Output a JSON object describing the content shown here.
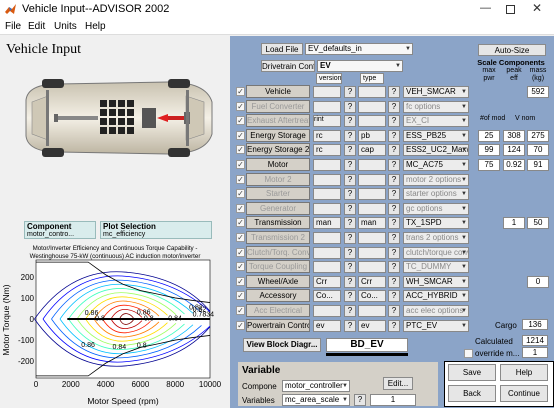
{
  "window": {
    "title": "Vehicle Input--ADVISOR 2002"
  },
  "menu": [
    "File",
    "Edit",
    "Units",
    "Help"
  ],
  "heading": "Vehicle Input",
  "component_select": {
    "label": "Component",
    "value": "motor_contro..."
  },
  "plot_select": {
    "label": "Plot Selection",
    "value": "mc_efficiency"
  },
  "plot": {
    "title_line1": "Motor/Inverter Efficiency and Continuous Torque Capability -",
    "title_line2": "Westinghouse 75-kW (continuous) AC induction motor/inverter",
    "xlabel": "Motor Speed (rpm)",
    "ylabel": "Motor Torque (Nm)",
    "xticks": [
      "0",
      "2000",
      "4000",
      "6000",
      "8000",
      "10000"
    ],
    "yticks": [
      "-200",
      "-100",
      "0",
      "100",
      "200"
    ],
    "contour_labels": [
      {
        "text": "0.86",
        "x": 2800,
        "y": 18
      },
      {
        "text": "0.86",
        "x": 5800,
        "y": 22
      },
      {
        "text": "0.8",
        "x": 3400,
        "y": -8
      },
      {
        "text": "0.8",
        "x": 6200,
        "y": -6
      },
      {
        "text": "0.84",
        "x": 7600,
        "y": -8
      },
      {
        "text": "0.7834",
        "x": 9000,
        "y": 12
      },
      {
        "text": "0.82",
        "x": 8800,
        "y": 44
      },
      {
        "text": "0.82",
        "x": 9000,
        "y": 36
      },
      {
        "text": "0.86",
        "x": 2600,
        "y": -132
      },
      {
        "text": "0.8",
        "x": 5800,
        "y": -136
      },
      {
        "text": "0.84",
        "x": 4400,
        "y": -142
      }
    ],
    "contour_levels": [
      0.5,
      0.6,
      0.7,
      0.75,
      0.78,
      0.8,
      0.82,
      0.84,
      0.86,
      0.88,
      0.9
    ],
    "contour_colors": [
      "#00008f",
      "#0000ff",
      "#0060ff",
      "#00bfff",
      "#40ffbf",
      "#9fff60",
      "#ffdf00",
      "#ff8000",
      "#ff2000",
      "#bf0000",
      "#800000"
    ],
    "xlim": [
      0,
      10000
    ],
    "ylim": [
      -280,
      280
    ],
    "max_torque_curve": [
      [
        0,
        270
      ],
      [
        3000,
        270
      ],
      [
        4000,
        210
      ],
      [
        5000,
        165
      ],
      [
        6000,
        135
      ],
      [
        7000,
        118
      ],
      [
        8000,
        100
      ],
      [
        9000,
        88
      ],
      [
        10000,
        78
      ]
    ]
  },
  "load_file": {
    "label": "Load File",
    "value": "EV_defaults_in"
  },
  "drivetrain": {
    "label": "Drivetrain Config",
    "value": "EV"
  },
  "col_headers": {
    "version": "version",
    "type": "type"
  },
  "auto_size_label": "Auto-Size",
  "scale": {
    "title": "Scale Components",
    "max_pwr": "max\npwr",
    "peak_eff": "peak\neff",
    "mass": "mass\n(kg)",
    "num_mod": "#of mod",
    "v_nom": "V nom"
  },
  "components": [
    {
      "name": "Vehicle",
      "checked": true,
      "active": true,
      "version": "",
      "type": "",
      "file": "VEH_SMCAR",
      "file_dim": false,
      "nums": [
        "",
        "",
        "592"
      ]
    },
    {
      "name": "Fuel Converter",
      "checked": true,
      "active": false,
      "version": "",
      "type": "",
      "file": "fc options",
      "file_dim": true,
      "nums": [
        "",
        "",
        ""
      ]
    },
    {
      "name": "Exhaust Aftertreat",
      "checked": true,
      "active": false,
      "version": "",
      "type": "",
      "file": "EX_CI",
      "file_dim": true,
      "nums": [
        "",
        "",
        ""
      ]
    },
    {
      "name": "Energy Storage",
      "checked": true,
      "active": true,
      "version": "rc",
      "type": "pb",
      "file": "ESS_PB25",
      "file_dim": false,
      "nums": [
        "25",
        "308",
        "275"
      ]
    },
    {
      "name": "Energy Storage 2",
      "checked": true,
      "active": true,
      "version": "rc",
      "type": "cap",
      "file": "ESS2_UC2_Maxwell",
      "file_dim": false,
      "nums": [
        "99",
        "124",
        "70"
      ]
    },
    {
      "name": "Motor",
      "checked": true,
      "active": true,
      "version": "",
      "type": "",
      "file": "MC_AC75",
      "file_dim": false,
      "nums": [
        "75",
        "0.92",
        "91"
      ]
    },
    {
      "name": "Motor 2",
      "checked": true,
      "active": false,
      "version": "",
      "type": "",
      "file": "motor 2 options",
      "file_dim": true,
      "nums": [
        "",
        "",
        ""
      ]
    },
    {
      "name": "Starter",
      "checked": true,
      "active": false,
      "version": "",
      "type": "",
      "file": "starter options",
      "file_dim": true,
      "nums": [
        "",
        "",
        ""
      ]
    },
    {
      "name": "Generator",
      "checked": true,
      "active": false,
      "version": "",
      "type": "",
      "file": "gc options",
      "file_dim": true,
      "nums": [
        "",
        "",
        ""
      ]
    },
    {
      "name": "Transmission",
      "checked": true,
      "active": true,
      "version": "man",
      "type": "man",
      "file": "TX_1SPD",
      "file_dim": false,
      "nums": [
        "",
        "1",
        "50"
      ]
    },
    {
      "name": "Transmission 2",
      "checked": true,
      "active": false,
      "version": "",
      "type": "",
      "file": "trans 2 options",
      "file_dim": true,
      "nums": [
        "",
        "",
        ""
      ]
    },
    {
      "name": "Clutch/Torq. Conv",
      "checked": true,
      "active": false,
      "version": "",
      "type": "",
      "file": "clutch/torque conve...",
      "file_dim": true,
      "nums": [
        "",
        "",
        ""
      ]
    },
    {
      "name": "Torque Coupling",
      "checked": true,
      "active": false,
      "version": "",
      "type": "",
      "file": "TC_DUMMY",
      "file_dim": true,
      "nums": [
        "",
        "",
        ""
      ]
    },
    {
      "name": "Wheel/Axle",
      "checked": true,
      "active": true,
      "version": "Crr",
      "type": "Crr",
      "file": "WH_SMCAR",
      "file_dim": false,
      "nums": [
        "",
        "",
        "0"
      ]
    },
    {
      "name": "Accessory",
      "checked": true,
      "active": true,
      "version": "Co...",
      "type": "Co...",
      "file": "ACC_HYBRID",
      "file_dim": false,
      "nums": [
        "",
        "",
        ""
      ]
    },
    {
      "name": "Acc Electrical",
      "checked": true,
      "active": false,
      "version": "",
      "type": "",
      "file": "acc elec options",
      "file_dim": true,
      "nums": [
        "",
        "",
        ""
      ]
    },
    {
      "name": "Powertrain Control",
      "checked": true,
      "active": true,
      "version": "ev",
      "type": "ev",
      "file": "PTC_EV",
      "file_dim": false,
      "nums": [
        "",
        "",
        ""
      ]
    }
  ],
  "version_rint": "rint",
  "cargo": {
    "label": "Cargo",
    "value": "136"
  },
  "calculated": {
    "label": "Calculated",
    "value": "1214"
  },
  "override": {
    "label": "override m...",
    "value": "1"
  },
  "view_block": {
    "label": "View Block Diagr...",
    "value": "BD_EV"
  },
  "variable": {
    "title": "Variable",
    "component_label": "Compone",
    "component_value": "motor_controller",
    "variables_label": "Variables",
    "variables_value": "mc_area_scale",
    "value": "1",
    "edit_label": "Edit..."
  },
  "actions": {
    "save": "Save",
    "help": "Help",
    "back": "Back",
    "continue": "Continue"
  }
}
